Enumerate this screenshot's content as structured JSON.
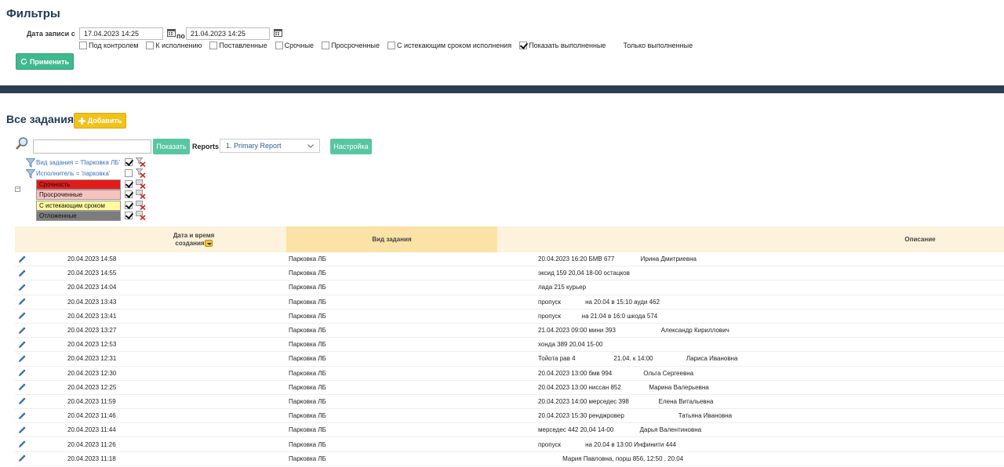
{
  "filters": {
    "title": "Фильтры",
    "date_label": "Дата записи с",
    "date_from": "17.04.2023 14:25",
    "to_label": "по",
    "date_to": "21.04.2023 14:25",
    "checkboxes": [
      {
        "label": "Под контролем",
        "checked": false
      },
      {
        "label": "К исполнению",
        "checked": false
      },
      {
        "label": "Поставленные",
        "checked": false
      },
      {
        "label": "Срочные",
        "checked": false
      },
      {
        "label": "Просроченные",
        "checked": false
      },
      {
        "label": "С истекающим сроком исполнения",
        "checked": false
      },
      {
        "label": "Показать выполненные",
        "checked": true
      },
      {
        "label": "Только выполненные",
        "checked": false
      }
    ],
    "apply_label": "Применить"
  },
  "tasks": {
    "title": "Все задания",
    "add_label": "Добавить",
    "show_label": "Показать",
    "reports_label": "Reports",
    "report_selected": "1. Primary Report",
    "settings_label": "Настройка",
    "active_filters": [
      {
        "text": "Вид задания = 'Парковка ЛБ'",
        "checked": true
      },
      {
        "text": "Исполнитель = 'парковка'",
        "checked": false
      }
    ],
    "legend": [
      {
        "label": "Срочность",
        "color": "#e31b1b",
        "checked": true
      },
      {
        "label": "Просроченные",
        "color": "#f7c1c1",
        "checked": true
      },
      {
        "label": "С истекающим сроком",
        "color": "#fffa9e",
        "checked": true
      },
      {
        "label": "Отложенные",
        "color": "#7c7c7c",
        "checked": true
      }
    ],
    "columns": {
      "date": "Дата и время создания",
      "type": "Вид задания",
      "desc": "Описание"
    },
    "rows": [
      {
        "date": "20.04.2023 14:58",
        "type": "Парковка ЛБ",
        "desc": "20.04.2023 16:20 БМВ 677               Ирина Дмитриевна"
      },
      {
        "date": "20.04.2023 14:55",
        "type": "Парковка ЛБ",
        "desc": "эксид 159 20,04 18-00 остацков"
      },
      {
        "date": "20.04.2023 14:04",
        "type": "Парковка ЛБ",
        "desc": "лада 215 курьер"
      },
      {
        "date": "20.04.2023 13:43",
        "type": "Парковка ЛБ",
        "desc": "пропуск              на 20.04 в 15:10 ауди 462"
      },
      {
        "date": "20.04.2023 13:41",
        "type": "Парковка ЛБ",
        "desc": "пропуск            на 21.04 в 16:0 шкода 574"
      },
      {
        "date": "20.04.2023 13:27",
        "type": "Парковка ЛБ",
        "desc": "21.04.2023 09:00 мини 393                          Александр Кириллович"
      },
      {
        "date": "20.04.2023 12:53",
        "type": "Парковка ЛБ",
        "desc": "хонда 389 20,04 15-00"
      },
      {
        "date": "20.04.2023 12:31",
        "type": "Парковка ЛБ",
        "desc": "Тойота рав 4                      21.04. к 14:00                   Лариса Ивановна"
      },
      {
        "date": "20.04.2023 12:30",
        "type": "Парковка ЛБ",
        "desc": "20.04.2023 13:00 бмв 994                  Ольга Сергеевна"
      },
      {
        "date": "20.04.2023 12:25",
        "type": "Парковка ЛБ",
        "desc": "20.04.2023 13:00 ниссан 852                Марина Валерьевна"
      },
      {
        "date": "20.04.2023 11:59",
        "type": "Парковка ЛБ",
        "desc": "20.04.2023 14:00 мерседес 398                 Елена Витальевна"
      },
      {
        "date": "20.04.2023 11:46",
        "type": "Парковка ЛБ",
        "desc": "20.04.2023 15:30 ренджровер                               Татьяна Ивановна"
      },
      {
        "date": "20.04.2023 11:44",
        "type": "Парковка ЛБ",
        "desc": "мерседес 442 20,04 14-00               Дарья Валентиновна"
      },
      {
        "date": "20.04.2023 11:26",
        "type": "Парковка ЛБ",
        "desc": "пропуск              на 20.04 в 13:00 Инфинити 444"
      },
      {
        "date": "20.04.2023 11:18",
        "type": "Парковка ЛБ",
        "desc": "              Мария Павловна, порш 856, 12:50 , 20.04"
      }
    ]
  }
}
